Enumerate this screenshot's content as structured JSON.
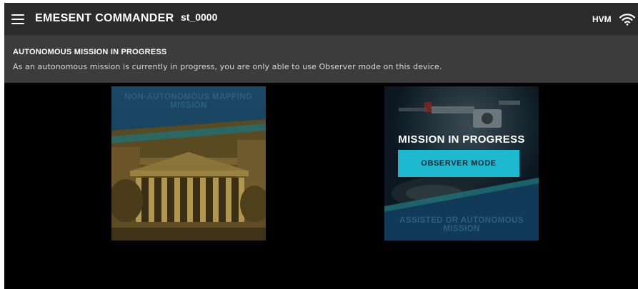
{
  "header": {
    "app_title": "EMESENT COMMANDER",
    "device_id": "st_0000",
    "status_label": "HVM",
    "menu_icon": "hamburger-menu-icon",
    "wifi_icon": "wifi-icon"
  },
  "banner": {
    "title": "AUTONOMOUS MISSION IN PROGRESS",
    "message": "As an autonomous mission is currently in progress, you are only able to use Observer mode on this device."
  },
  "cards": {
    "non_autonomous": {
      "label": "NON-AUTONOMOUS MAPPING MISSION"
    },
    "autonomous": {
      "label": "ASSISTED OR AUTONOMOUS MISSION",
      "status_title": "MISSION IN PROGRESS",
      "button_label": "OBSERVER MODE"
    }
  },
  "colors": {
    "background": "#000000",
    "topbar": "#2b2b2b",
    "banner": "#3c3c3c",
    "accent": "#1cb9cf",
    "card_overlay": "#103a57"
  }
}
